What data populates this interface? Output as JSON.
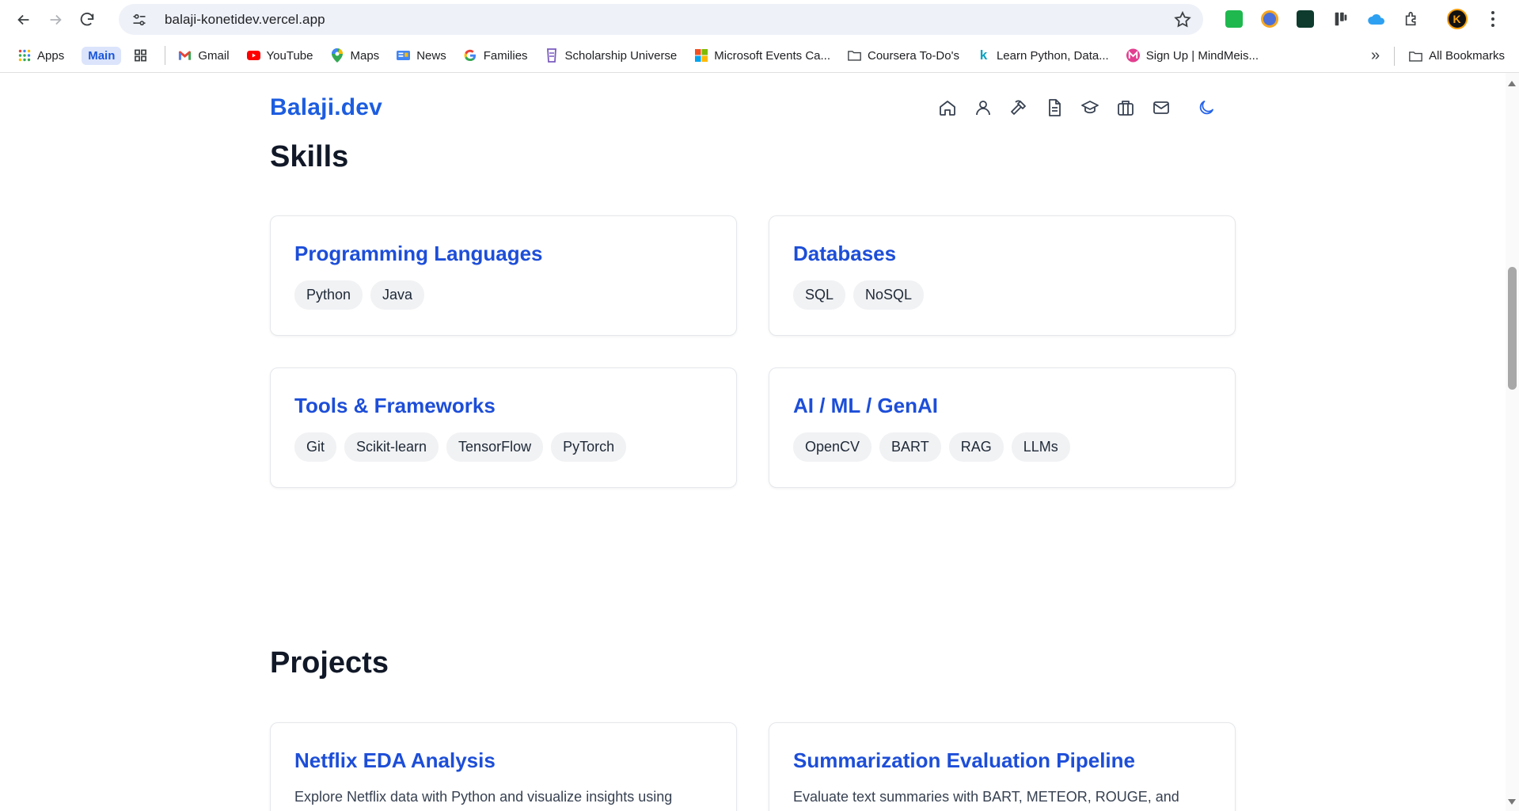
{
  "browser": {
    "url": "balaji-konetidev.vercel.app",
    "avatar_letter": "K",
    "bookmarks": [
      {
        "label": "Apps",
        "icon": "apps-grid-icon"
      },
      {
        "label": "Main",
        "icon": ""
      },
      {
        "label": "Gmail",
        "icon": "gmail-icon"
      },
      {
        "label": "YouTube",
        "icon": "youtube-icon"
      },
      {
        "label": "Maps",
        "icon": "maps-icon"
      },
      {
        "label": "News",
        "icon": "news-icon"
      },
      {
        "label": "Families",
        "icon": "google-icon"
      },
      {
        "label": "Scholarship Universe",
        "icon": "scholarship-icon"
      },
      {
        "label": "Microsoft Events Ca...",
        "icon": "microsoft-icon"
      },
      {
        "label": "Coursera To-Do's",
        "icon": "folder-icon"
      },
      {
        "label": "Learn Python, Data...",
        "icon": "k-icon"
      },
      {
        "label": "Sign Up | MindMeis...",
        "icon": "mindmeister-icon"
      }
    ],
    "all_bookmarks": "All Bookmarks"
  },
  "site": {
    "logo": "Balaji.dev"
  },
  "skills": {
    "title": "Skills",
    "cards": [
      {
        "title": "Programming Languages",
        "pills": [
          "Python",
          "Java"
        ]
      },
      {
        "title": "Databases",
        "pills": [
          "SQL",
          "NoSQL"
        ]
      },
      {
        "title": "Tools & Frameworks",
        "pills": [
          "Git",
          "Scikit-learn",
          "TensorFlow",
          "PyTorch"
        ]
      },
      {
        "title": "AI / ML / GenAI",
        "pills": [
          "OpenCV",
          "BART",
          "RAG",
          "LLMs"
        ]
      }
    ]
  },
  "projects": {
    "title": "Projects",
    "cards": [
      {
        "title": "Netflix EDA Analysis",
        "desc": "Explore Netflix data with Python and visualize insights using"
      },
      {
        "title": "Summarization Evaluation Pipeline",
        "desc": "Evaluate text summaries with BART, METEOR, ROUGE, and LLM-"
      }
    ]
  },
  "colors": {
    "accent": "#1d4ed8",
    "logo": "#1d5de0"
  }
}
